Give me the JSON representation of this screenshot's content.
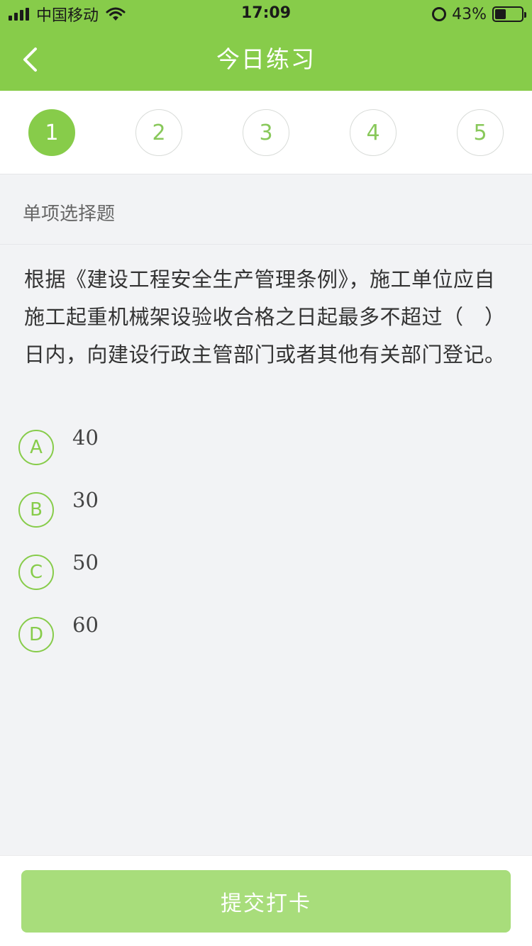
{
  "status_bar": {
    "carrier": "中国移动",
    "time": "17:09",
    "battery_percent": "43%",
    "battery_level": 0.43,
    "icons": [
      "signal-icon",
      "wifi-icon",
      "alarm-icon",
      "battery-icon"
    ]
  },
  "nav": {
    "title": "今日练习",
    "back_icon": "chevron-left-icon"
  },
  "steps": {
    "items": [
      "1",
      "2",
      "3",
      "4",
      "5"
    ],
    "active_index": 0
  },
  "question": {
    "type": "单项选择题",
    "text": "根据《建设工程安全生产管理条例》，施工单位应自施工起重机械架设验收合格之日起最多不超过（　）日内，向建设行政主管部门或者其他有关部门登记。",
    "options": [
      {
        "letter": "A",
        "text": "40"
      },
      {
        "letter": "B",
        "text": "30"
      },
      {
        "letter": "C",
        "text": "50"
      },
      {
        "letter": "D",
        "text": "60"
      }
    ]
  },
  "footer": {
    "submit_label": "提交打卡"
  },
  "colors": {
    "brand_green": "#87cc4a",
    "button_green_disabled": "#a8dd7b",
    "background": "#f2f3f5"
  }
}
